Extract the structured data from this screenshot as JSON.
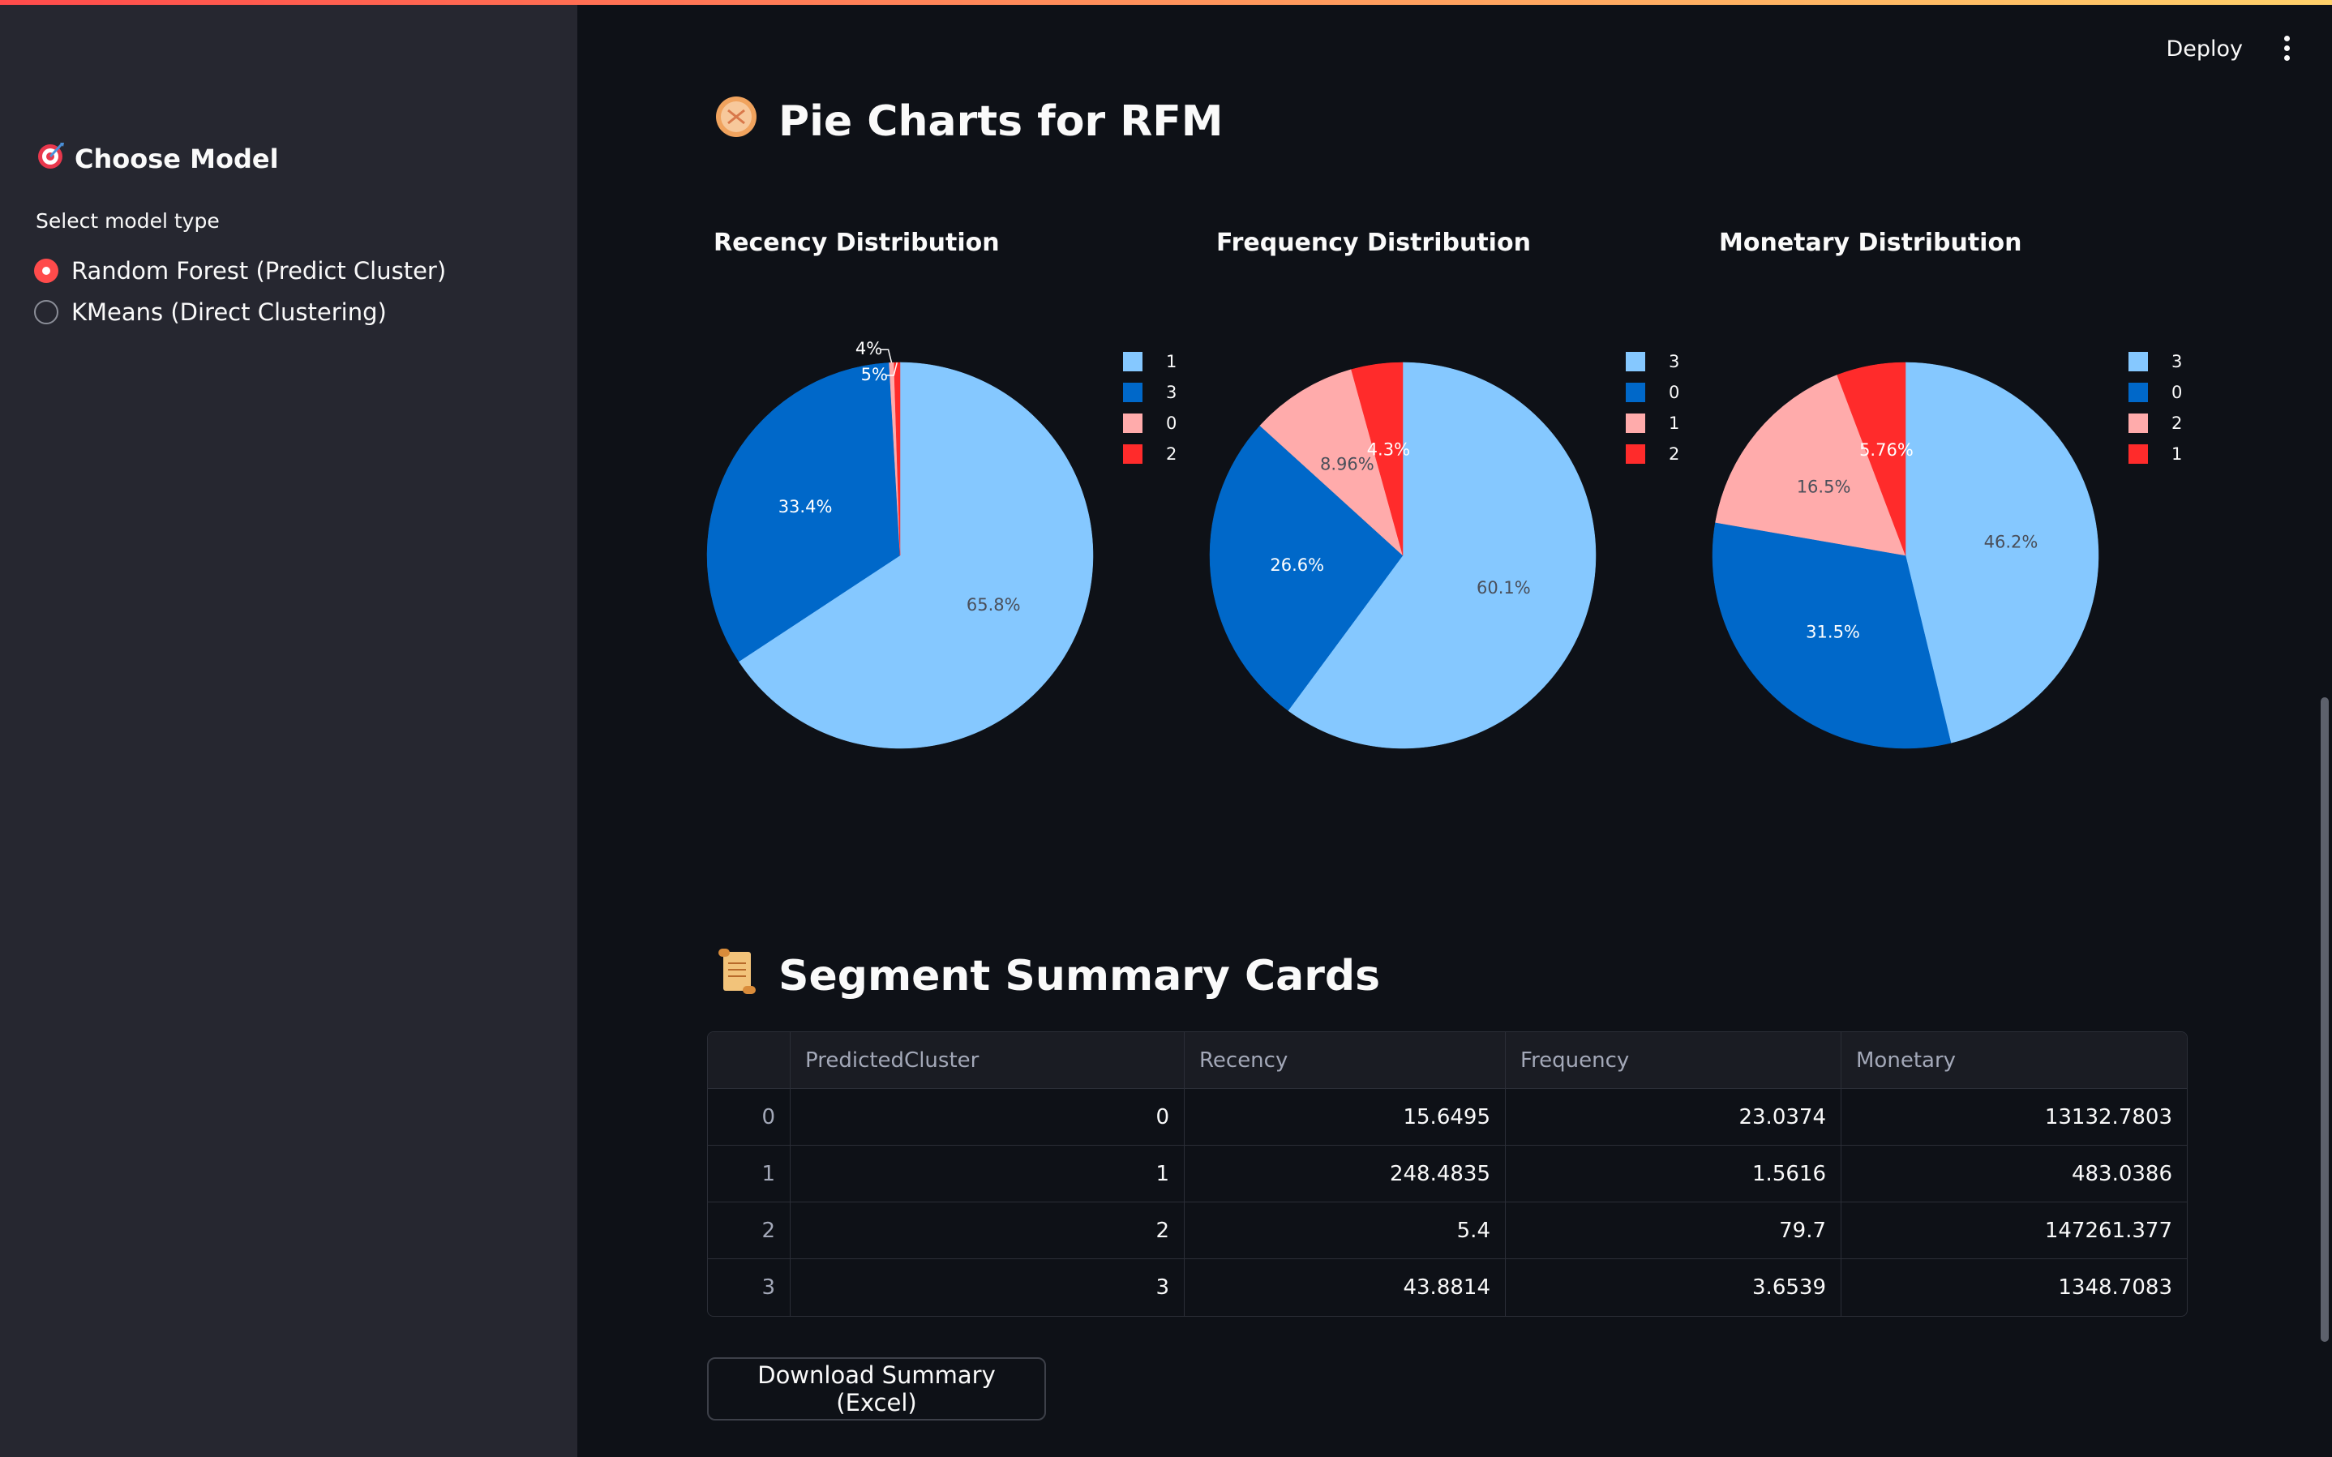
{
  "sidebar": {
    "title": "Choose Model",
    "radio_label": "Select model type",
    "options": [
      {
        "label": "Random Forest (Predict Cluster)",
        "selected": true
      },
      {
        "label": "KMeans (Direct Clustering)",
        "selected": false
      }
    ]
  },
  "header": {
    "deploy_label": "Deploy"
  },
  "main": {
    "pie_section_title": "Pie Charts for RFM",
    "summary_section_title": "Segment Summary Cards",
    "download_label": "Download Summary (Excel)"
  },
  "colors": {
    "light_blue": "#85c8ff",
    "dark_blue": "#0068c9",
    "pink": "#ffabab",
    "red": "#ff2b2b",
    "accent": "#ff4b4b"
  },
  "chart_data": [
    {
      "type": "pie",
      "title": "Recency Distribution",
      "legend_position": "right",
      "slices": [
        {
          "label": "1",
          "value": 65.8,
          "display": "65.8%",
          "color": "#85c8ff"
        },
        {
          "label": "3",
          "value": 33.4,
          "display": "33.4%",
          "color": "#0068c9"
        },
        {
          "label": "0",
          "value": 0.4,
          "display": "4%",
          "color": "#ffabab"
        },
        {
          "label": "2",
          "value": 0.5,
          "display": "5%",
          "color": "#ff2b2b"
        }
      ]
    },
    {
      "type": "pie",
      "title": "Frequency Distribution",
      "legend_position": "right",
      "slices": [
        {
          "label": "3",
          "value": 60.1,
          "display": "60.1%",
          "color": "#85c8ff"
        },
        {
          "label": "0",
          "value": 26.6,
          "display": "26.6%",
          "color": "#0068c9"
        },
        {
          "label": "1",
          "value": 8.96,
          "display": "8.96%",
          "color": "#ffabab"
        },
        {
          "label": "2",
          "value": 4.3,
          "display": "4.3%",
          "color": "#ff2b2b"
        }
      ]
    },
    {
      "type": "pie",
      "title": "Monetary Distribution",
      "legend_position": "right",
      "slices": [
        {
          "label": "3",
          "value": 46.2,
          "display": "46.2%",
          "color": "#85c8ff"
        },
        {
          "label": "0",
          "value": 31.5,
          "display": "31.5%",
          "color": "#0068c9"
        },
        {
          "label": "2",
          "value": 16.5,
          "display": "16.5%",
          "color": "#ffabab"
        },
        {
          "label": "1",
          "value": 5.76,
          "display": "5.76%",
          "color": "#ff2b2b"
        }
      ]
    }
  ],
  "table": {
    "columns": [
      "",
      "PredictedCluster",
      "Recency",
      "Frequency",
      "Monetary"
    ],
    "rows": [
      [
        "0",
        "0",
        "15.6495",
        "23.0374",
        "13132.7803"
      ],
      [
        "1",
        "1",
        "248.4835",
        "1.5616",
        "483.0386"
      ],
      [
        "2",
        "2",
        "5.4",
        "79.7",
        "147261.377"
      ],
      [
        "3",
        "3",
        "43.8814",
        "3.6539",
        "1348.7083"
      ]
    ]
  }
}
